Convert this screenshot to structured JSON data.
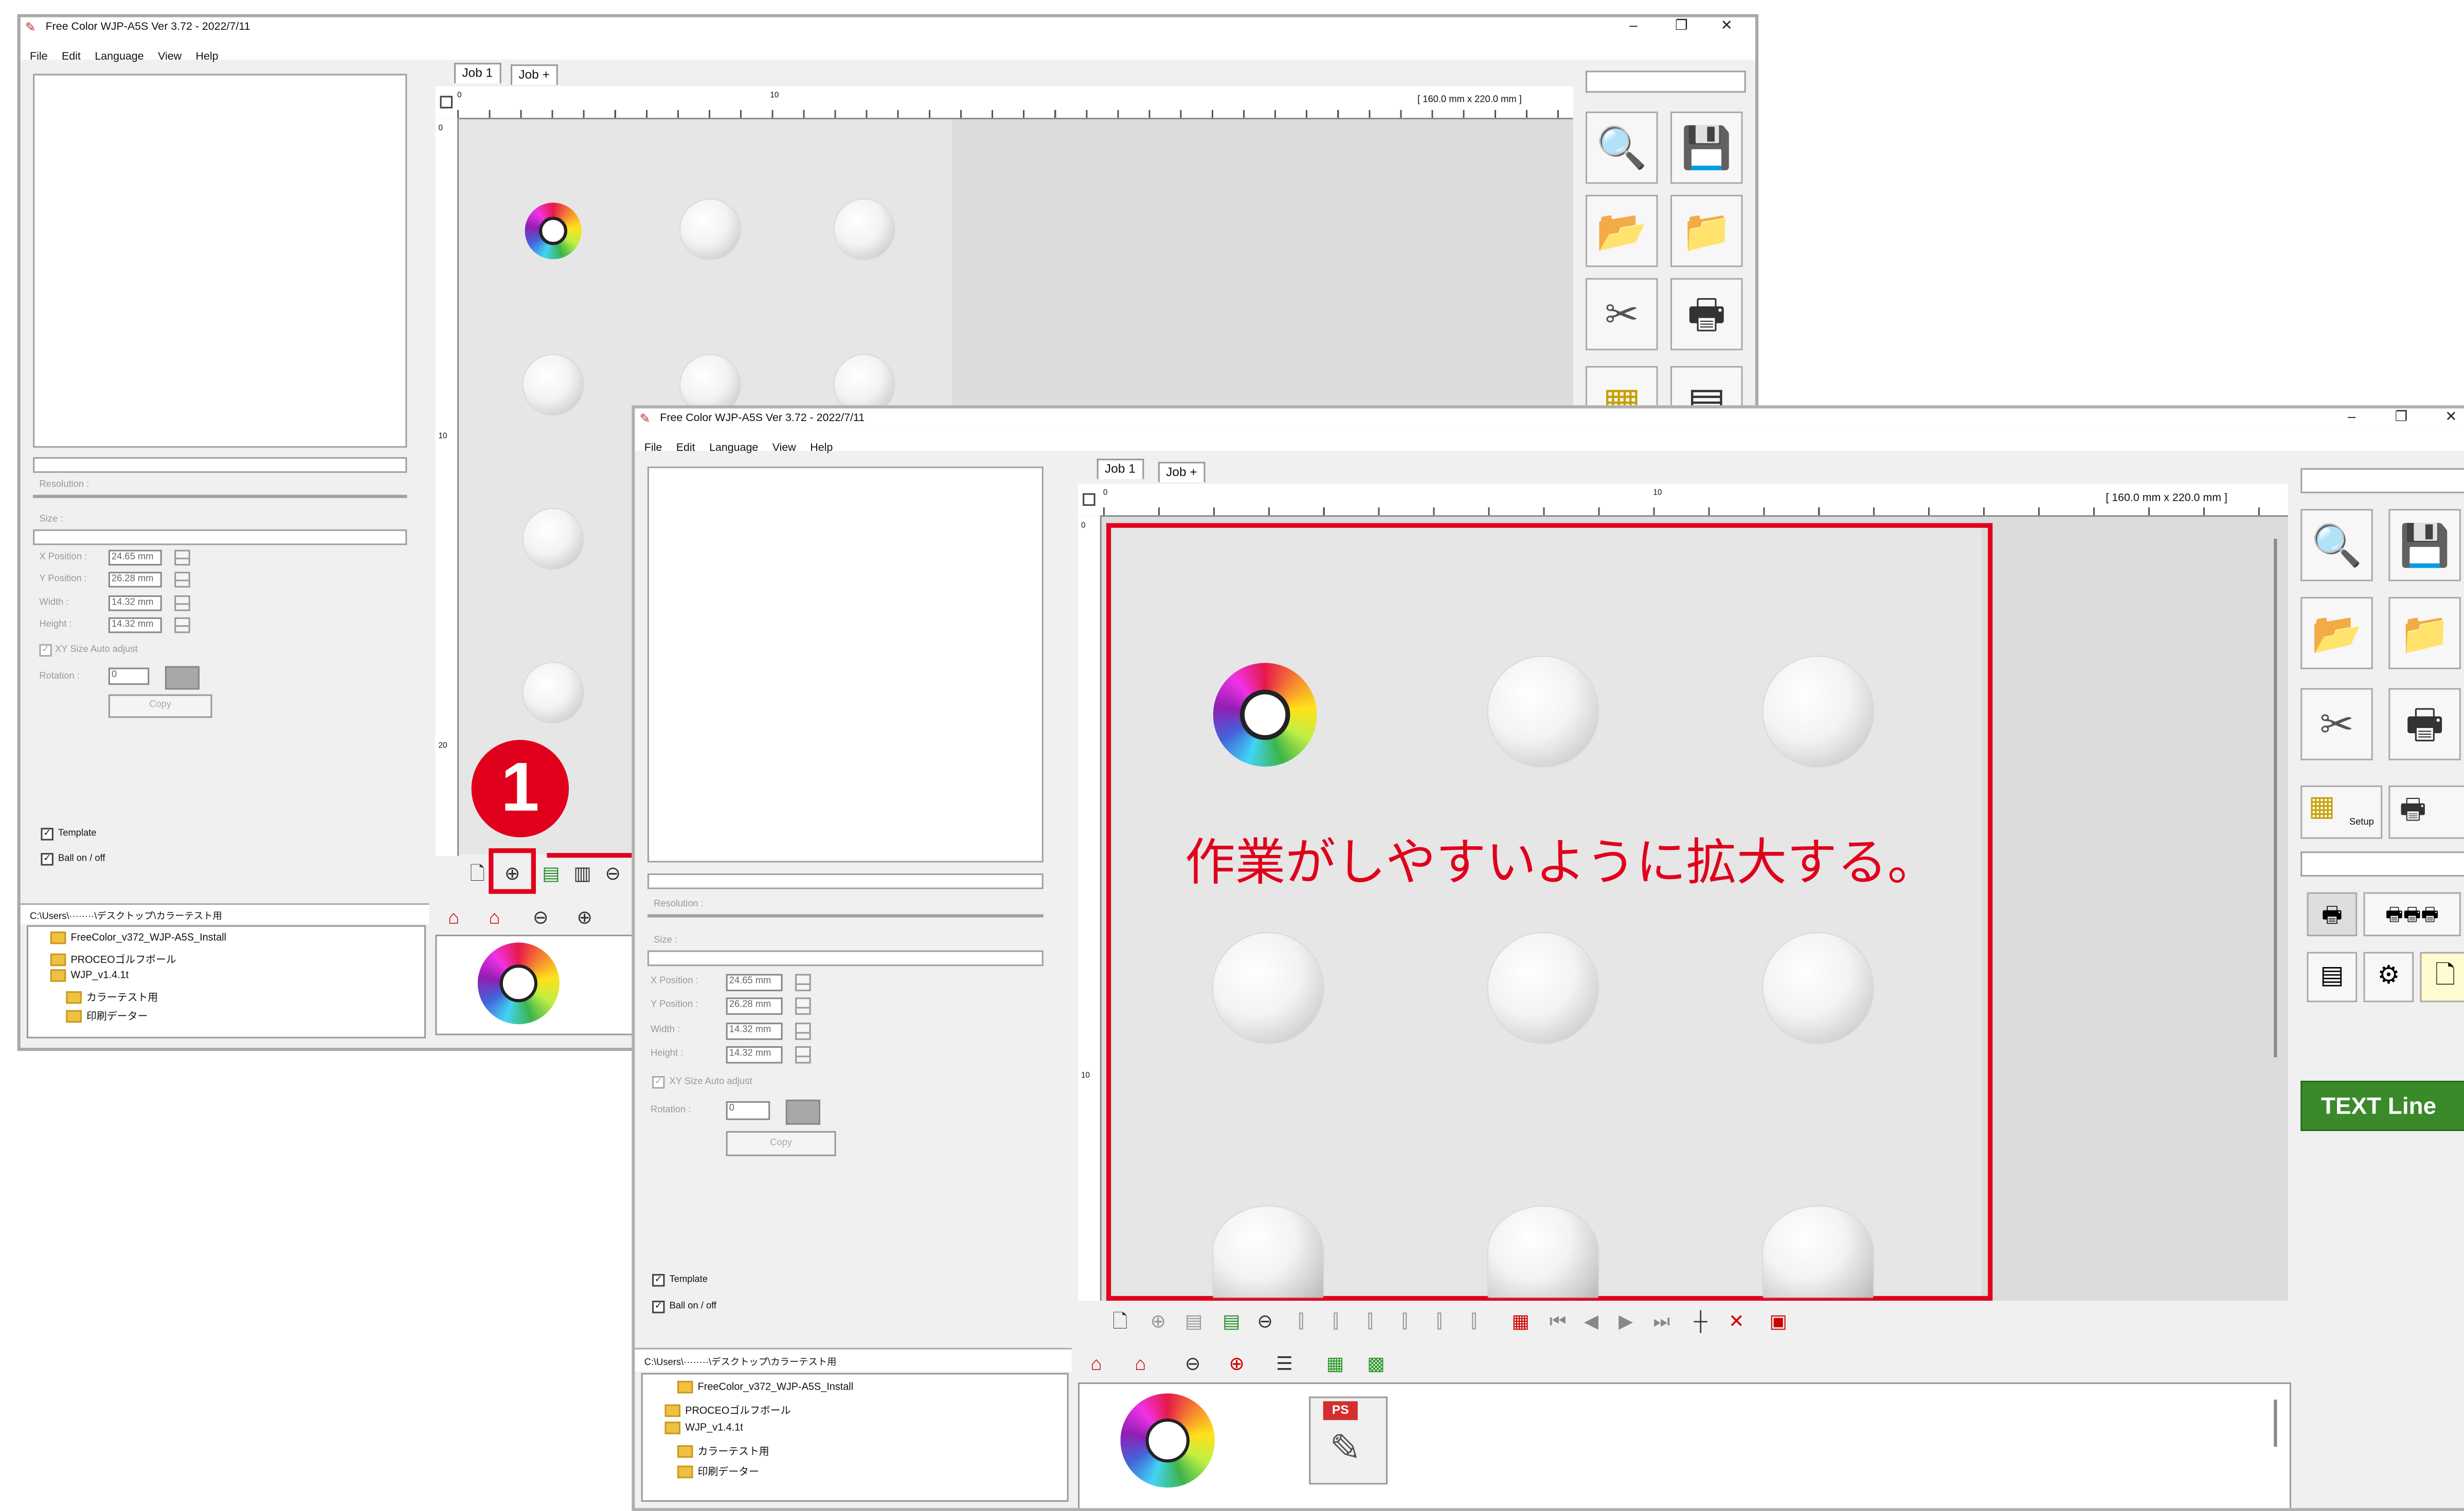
{
  "window1": {
    "title": "Free Color WJP-A5S Ver 3.72 - 2022/7/11",
    "menu": [
      "File",
      "Edit",
      "Language",
      "View",
      "Help"
    ],
    "tabs": [
      "Job 1",
      "Job +"
    ],
    "ruler_size": "[ 160.0 mm x 220.0 mm ]",
    "ruler_top_labels": [
      "0",
      "10"
    ],
    "ruler_left_labels": [
      "0",
      "10",
      "20"
    ],
    "resolution_label": "Resolution :",
    "size_label": "Size :",
    "fields": [
      {
        "label": "X Position :",
        "value": "24.65 mm"
      },
      {
        "label": "Y Position :",
        "value": "26.28 mm"
      },
      {
        "label": "Width :",
        "value": "14.32 mm"
      },
      {
        "label": "Height :",
        "value": "14.32 mm"
      }
    ],
    "xy_auto": "XY Size Auto adjust",
    "rotation_label": "Rotation :",
    "rotation_value": "0",
    "copy_button": "Copy",
    "template_label": "Template",
    "ball_label": "Ball on / off",
    "path": "C:\\Users\\········\\デスクトップ\\カラーテスト用",
    "tree": [
      "FreeColor_v372_WJP-A5S_Install",
      "PROCEOゴルフボール",
      "WJP_v1.4.1t",
      "カラーテスト用",
      "印刷データー"
    ]
  },
  "window2": {
    "title": "Free Color WJP-A5S Ver 3.72 - 2022/7/11",
    "menu": [
      "File",
      "Edit",
      "Language",
      "View",
      "Help"
    ],
    "tabs": [
      "Job 1",
      "Job +"
    ],
    "ruler_size": "[ 160.0 mm x 220.0 mm ]",
    "ruler_top_labels": [
      "0",
      "10"
    ],
    "ruler_left_labels": [
      "0",
      "10"
    ],
    "resolution_label": "Resolution :",
    "size_label": "Size :",
    "fields": [
      {
        "label": "X Position :",
        "value": "24.65 mm"
      },
      {
        "label": "Y Position :",
        "value": "26.28 mm"
      },
      {
        "label": "Width :",
        "value": "14.32 mm"
      },
      {
        "label": "Height :",
        "value": "14.32 mm"
      }
    ],
    "xy_auto": "XY Size Auto adjust",
    "rotation_label": "Rotation :",
    "rotation_value": "0",
    "copy_button": "Copy",
    "template_label": "Template",
    "ball_label": "Ball on / off",
    "path": "C:\\Users\\········\\デスクトップ\\カラーテスト用",
    "tree": [
      "FreeColor_v372_WJP-A5S_Install",
      "PROCEOゴルフボール",
      "WJP_v1.4.1t",
      "カラーテスト用",
      "印刷データー"
    ],
    "setup_label": "Setup",
    "text_line_button": "TEXT Line",
    "thumb_ps": "PS"
  },
  "annotation": {
    "step_number": "1",
    "caption": "作業がしやすいように拡大する。",
    "color": "#e0001b"
  },
  "icons": [
    "zoom-icon",
    "save-icon",
    "open-folder-icon",
    "import-icon",
    "tools-icon",
    "printer-icon",
    "setup-icon",
    "print-layout-icon",
    "new-icon",
    "zoom-in-icon",
    "zoom-out-icon",
    "delete-icon"
  ]
}
